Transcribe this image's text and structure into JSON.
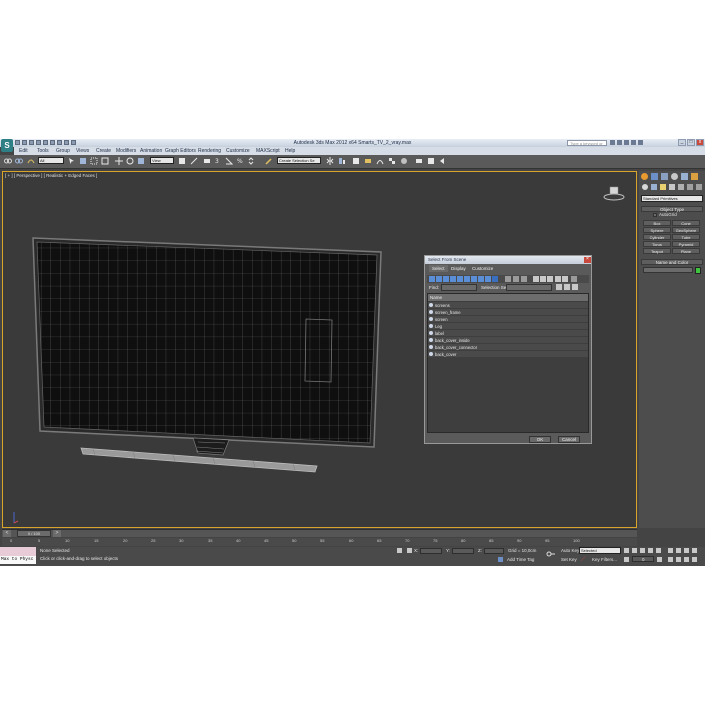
{
  "app": {
    "logo_letter": "S",
    "title": "Autodesk 3ds Max 2012 x64     Smarts_TV_2_vray.max",
    "search_placeholder": "Type a keyword or phrase",
    "window_controls": [
      "_",
      "□",
      "x"
    ]
  },
  "menu": [
    "Edit",
    "Tools",
    "Group",
    "Views",
    "Create",
    "Modifiers",
    "Animation",
    "Graph Editors",
    "Rendering",
    "Customize",
    "MAXScript",
    "Help"
  ],
  "toolbar": {
    "filter_value": "All",
    "coord_value": "View",
    "named_selection": "Create Selection Se"
  },
  "viewport": {
    "label": "[ + ] [ Perspective ] [ Realistic + Edged Faces ]"
  },
  "command_panel": {
    "dropdown": "Standard Primitives",
    "object_type_header": "Object Type",
    "autogrid": "AutoGrid",
    "buttons": [
      "Box",
      "Cone",
      "Sphere",
      "GeoSphere",
      "Cylinder",
      "Tube",
      "Torus",
      "Pyramid",
      "Teapot",
      "Plane"
    ],
    "name_color_header": "Name and Color"
  },
  "dialog": {
    "title": "Select From Scene",
    "tabs": [
      "Select",
      "Display",
      "Customize"
    ],
    "find_label": "Find:",
    "selection_set_label": "Selection Set:",
    "column_header": "Name",
    "items": [
      "screens",
      "screen_frame",
      "screen",
      "Leg",
      "label",
      "back_cover_inside",
      "back_cover_connector",
      "back_cover"
    ],
    "ok": "OK",
    "cancel": "Cancel"
  },
  "timeline": {
    "position": "0 / 100",
    "ticks": [
      "0",
      "5",
      "10",
      "15",
      "20",
      "25",
      "30",
      "35",
      "40",
      "45",
      "50",
      "55",
      "60",
      "65",
      "70",
      "75",
      "80",
      "85",
      "90",
      "95",
      "100"
    ]
  },
  "status": {
    "maxscript_text": "Max to Physc",
    "line1": "None Selected",
    "line2": "Click or click-and-drag to select objects",
    "grid": "Grid = 10,0cm",
    "add_time_tag": "Add Time Tag",
    "auto_key": "Auto Key",
    "auto_key_value": "Selected",
    "set_key": "Set Key",
    "key_filters": "Key Filters...",
    "frame": "0"
  },
  "colors": {
    "app_bg": "#444444",
    "viewport_bg": "#3a3a3a",
    "active_border": "#d8a52a",
    "dialog_bg": "#5a5a5a",
    "swatch_green": "#3fc43f"
  }
}
